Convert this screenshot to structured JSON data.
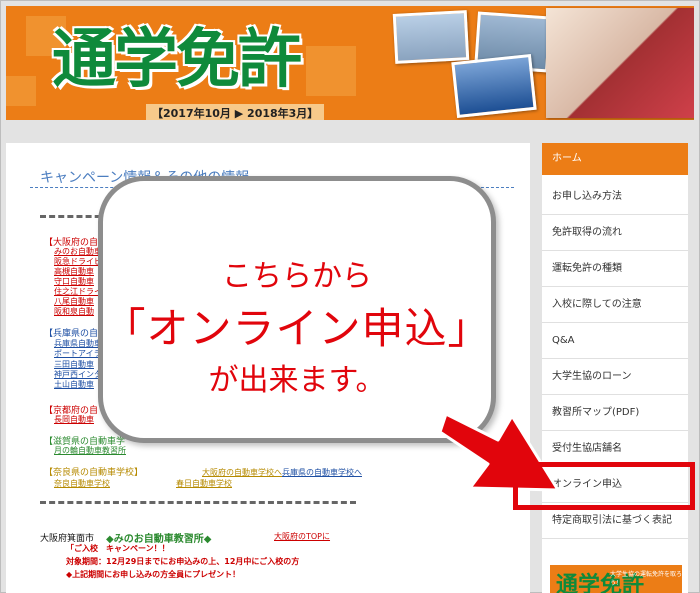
{
  "header": {
    "title": "通学免許",
    "period": "【2017年10月 ▶ 2018年3月】"
  },
  "content": {
    "section_title": "キャンペーン情報＆その他の情報",
    "groups": [
      {
        "pref": "【大阪府の自",
        "schools": [
          "みのお自動車",
          "阪急ドライビ",
          "高槻自動車",
          "守口自動車",
          "住之江ドライ",
          "八尾自動車",
          "阪和泉自動"
        ]
      },
      {
        "pref": "【兵庫県の自",
        "schools": [
          "兵庫県自動車",
          "ポートアイラ",
          "三田自動車",
          "神戸西インタ",
          "土山自動車"
        ]
      },
      {
        "pref": "【京都府の自",
        "schools": [
          "長岡自動車"
        ]
      },
      {
        "pref": "【滋賀県の自動車学",
        "schools": [
          "月の輪自動車教習所"
        ]
      },
      {
        "pref": "【奈良県の自動車学校】",
        "schools": [
          "奈良自動車学校"
        ]
      }
    ],
    "nara_links": [
      "大阪府の自動車学校へ",
      "兵庫県の自動車学校へ",
      "春日自動車学校"
    ],
    "bottom_city": "大阪府箕面市",
    "bottom_school": "◆みのお自動車教習所◆",
    "bottom_top_link": "大阪府のTOPに",
    "notice_lines": [
      "「ご入校　キャンペーン！！",
      "対象期間：12月29日までにお申込みの上、12月中にご入校の方",
      "◆上記期間にお申し込みの方全員にプレゼント！"
    ]
  },
  "callout": {
    "line1": "こちらから",
    "line2": "「オンライン申込」",
    "line3": "が出来ます。"
  },
  "sidebar": {
    "items": [
      {
        "label": "ホーム"
      },
      {
        "label": "お申し込み方法"
      },
      {
        "label": "免許取得の流れ"
      },
      {
        "label": "運転免許の種類"
      },
      {
        "label": "入校に際しての注意"
      },
      {
        "label": "Q&A"
      },
      {
        "label": "大学生協のローン"
      },
      {
        "label": "教習所マップ(PDF)"
      },
      {
        "label": "受付生協店舗名"
      },
      {
        "label": "オンライン申込"
      },
      {
        "label": "特定商取引法に基づく表記"
      }
    ],
    "banner_text": "通学免許",
    "banner_sub": "大学生協の運転免許を取ろう！"
  },
  "colors": {
    "brand_orange": "#ec7d16",
    "brand_green": "#0f8a3b",
    "alert_red": "#e1050c",
    "link_blue": "#4c7ec0"
  }
}
